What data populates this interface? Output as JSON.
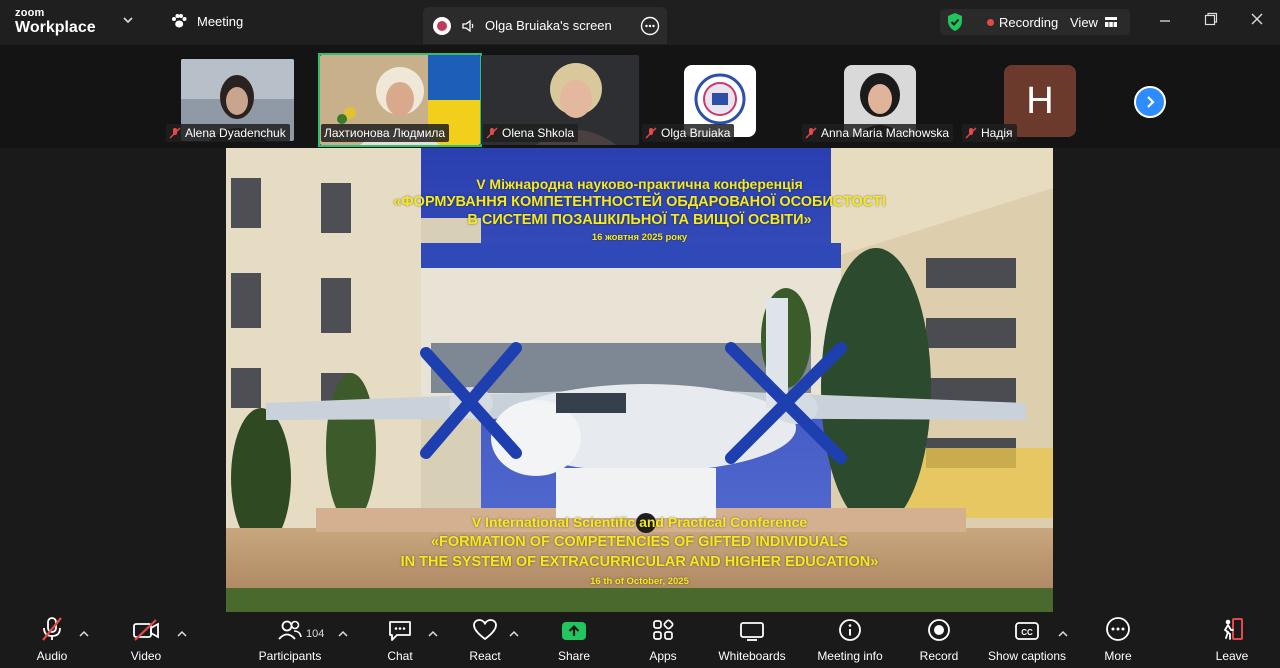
{
  "app": {
    "brand_top": "zoom",
    "brand_bottom": "Workplace"
  },
  "header": {
    "meeting_label": "Meeting",
    "screen_label": "Olga Bruiaka's screen",
    "recording_label": "Recording",
    "view_label": "View"
  },
  "participants_strip": [
    {
      "name": "Alena Dyadenchuk",
      "muted": true
    },
    {
      "name": "Лахтионова Людмила",
      "muted": false,
      "active": true
    },
    {
      "name": "Olena Shkola",
      "muted": true
    },
    {
      "name": "Olga Bruiaka",
      "muted": true
    },
    {
      "name": "Anna Maria Machowska",
      "muted": true
    },
    {
      "name": "Надія",
      "muted": true,
      "initial": "H"
    }
  ],
  "slide": {
    "ua_line1": "V Міжнародна науково-практична конференція",
    "ua_line2": "«ФОРМУВАННЯ КОМПЕТЕНТНОСТЕЙ ОБДАРОВАНОЇ ОСОБИСТОСТІ",
    "ua_line3": "В СИСТЕМІ ПОЗАШКІЛЬНОЇ ТА ВИЩОЇ ОСВІТИ»",
    "ua_date": "16 жовтня 2025 року",
    "en_line1": "V International Scientific and Practical Conference",
    "en_line2": "«FORMATION OF COMPETENCIES OF GIFTED INDIVIDUALS",
    "en_line3": "IN THE SYSTEM OF EXTRACURRICULAR AND HIGHER EDUCATION»",
    "en_date": "16 th of  October, 2025",
    "text_color": "#f5ea1d"
  },
  "toolbar": {
    "audio": "Audio",
    "video": "Video",
    "participants": "Participants",
    "participants_count": "104",
    "chat": "Chat",
    "react": "React",
    "share": "Share",
    "apps": "Apps",
    "whiteboards": "Whiteboards",
    "meeting_info": "Meeting info",
    "record": "Record",
    "show_captions": "Show captions",
    "more": "More",
    "leave": "Leave"
  },
  "colors": {
    "accent_green": "#2fbf71",
    "share_green": "#22c55e",
    "muted_red": "#e54848",
    "leave_red": "#e5484d",
    "blue": "#2d8cff"
  }
}
